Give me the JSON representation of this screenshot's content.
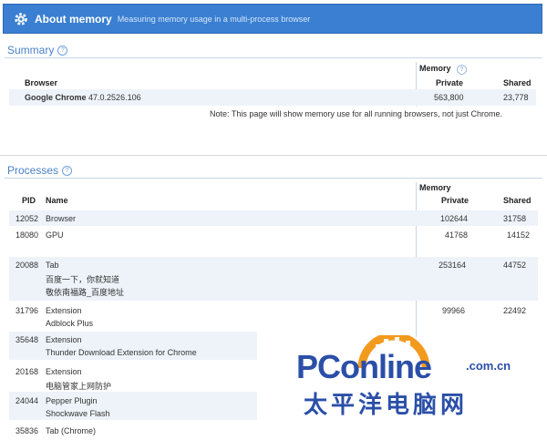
{
  "header": {
    "title": "About memory",
    "subtitle": "Measuring memory usage in a multi-process browser"
  },
  "summary": {
    "title": "Summary",
    "memory_label": "Memory",
    "col_browser": "Browser",
    "col_private": "Private",
    "col_shared": "Shared",
    "browser_name": "Google Chrome",
    "browser_version": "47.0.2526.106",
    "private": "563,800",
    "shared": "23,778",
    "note": "Note: This page will show memory use for all running browsers, not just Chrome."
  },
  "processes": {
    "title": "Processes",
    "memory_label": "Memory",
    "col_pid": "PID",
    "col_name": "Name",
    "col_private": "Private",
    "col_shared": "Shared",
    "rows": [
      {
        "pid": "12052",
        "name": "Browser",
        "detail1": "",
        "detail2": "",
        "private": "102644",
        "shared": "31758"
      },
      {
        "pid": "18080",
        "name": "GPU",
        "detail1": "",
        "detail2": "",
        "private": "41768",
        "shared": "14152"
      },
      {
        "pid": "20088",
        "name": "Tab",
        "detail1": "百度一下，你就知道",
        "detail2": "敬依南福路_百度地址",
        "private": "253164",
        "shared": "44752"
      },
      {
        "pid": "31796",
        "name": "Extension",
        "detail1": "Adblock Plus",
        "detail2": "",
        "private": "99966",
        "shared": "22492"
      },
      {
        "pid": "35648",
        "name": "Extension",
        "detail1": "Thunder Download Extension for Chrome",
        "detail2": "",
        "private": "",
        "shared": ""
      },
      {
        "pid": "20168",
        "name": "Extension",
        "detail1": "电脑管家上网防护",
        "detail2": "",
        "private": "",
        "shared": ""
      },
      {
        "pid": "24044",
        "name": "Pepper Plugin",
        "detail1": "Shockwave Flash",
        "detail2": "",
        "private": "",
        "shared": ""
      },
      {
        "pid": "35836",
        "name": "Tab (Chrome)",
        "detail1": "",
        "detail2": "",
        "private": "",
        "shared": ""
      }
    ]
  },
  "watermark": {
    "brand": "PConline",
    "domain": ".com.cn",
    "chinese": "太平洋电脑网"
  }
}
